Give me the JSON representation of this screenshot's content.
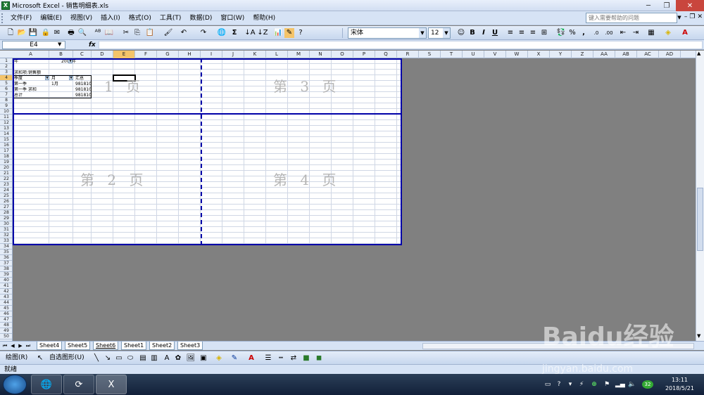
{
  "app_title": "Microsoft Excel - 销售明细表.xls",
  "menu": [
    "文件(F)",
    "编辑(E)",
    "视图(V)",
    "插入(I)",
    "格式(O)",
    "工具(T)",
    "数据(D)",
    "窗口(W)",
    "帮助(H)"
  ],
  "help_placeholder": "键入需要帮助的问题",
  "toolbar": {
    "font_name": "宋体",
    "font_size": "12",
    "bold": "B",
    "italic": "I",
    "underline": "U",
    "percent": "%",
    "comma": ",",
    "sum": "Σ"
  },
  "name_box": "E4",
  "fx_label": "fx",
  "columns": [
    "A",
    "B",
    "C",
    "D",
    "E",
    "F",
    "G",
    "H",
    "I",
    "J",
    "K",
    "L",
    "M",
    "N",
    "O",
    "P",
    "Q",
    "R",
    "S",
    "T",
    "U",
    "V",
    "W",
    "X",
    "Y",
    "Z",
    "AA",
    "AB",
    "AC",
    "AD"
  ],
  "active_column": "E",
  "active_row": "4",
  "rows_visible": 50,
  "cells": {
    "a1": "年",
    "b1": "2009年",
    "a3": "求和项:销售额",
    "a4": "季度",
    "b4": "月",
    "c4": "汇总",
    "a5": "第一季",
    "b5": "1月",
    "c5": "981810",
    "a6": "第一季 求和",
    "c6": "981810",
    "a7": "总计",
    "c7": "981810"
  },
  "page_labels": {
    "p1": "1 页",
    "p2": "第 2 页",
    "p3": "第 3 页",
    "p4": "第 4 页"
  },
  "sheet_tabs": [
    "Sheet4",
    "Sheet5",
    "Sheet6",
    "Sheet1",
    "Sheet2",
    "Sheet3"
  ],
  "active_sheet": "Sheet6",
  "drawing": {
    "draw_label": "绘图(R)",
    "autoshapes_label": "自选图形(U)"
  },
  "status": "就绪",
  "clock": {
    "time": "13:11",
    "date": "2018/5/21"
  },
  "tray_badge": "32",
  "watermark": "Baidu经验",
  "watermark_url": "jingyan.baidu.com"
}
